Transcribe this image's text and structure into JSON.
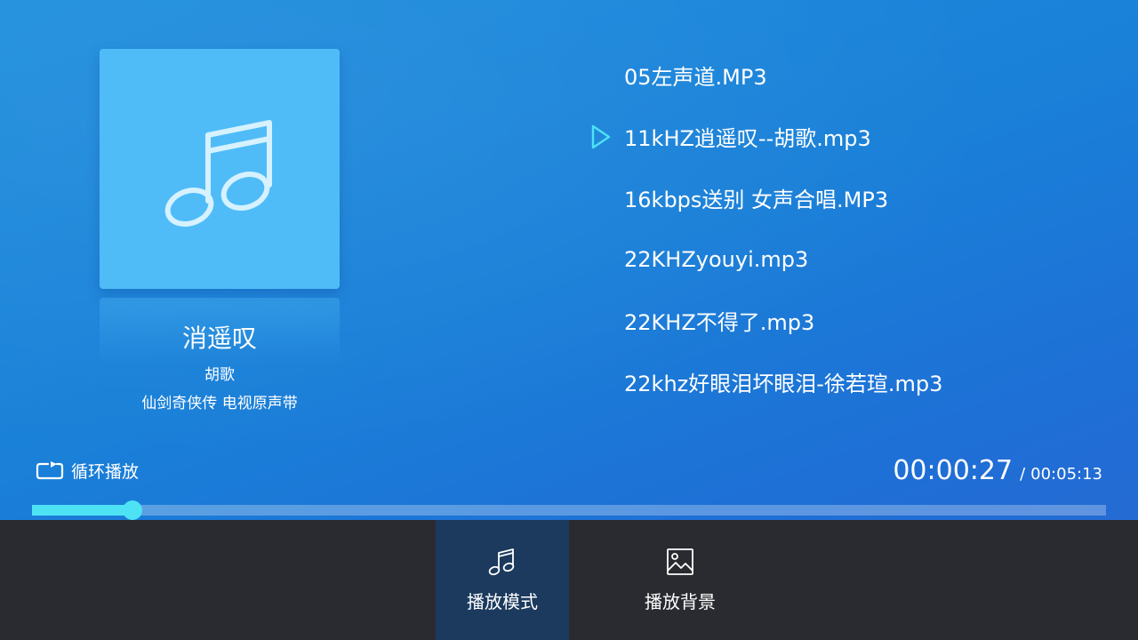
{
  "now_playing": {
    "title": "消遥叹",
    "artist": "胡歌",
    "album": "仙剑奇侠传 电视原声带",
    "cover_icon": "music-note-icon"
  },
  "playlist": {
    "current_index": 1,
    "items": [
      {
        "name": "05左声道.MP3"
      },
      {
        "name": "11kHZ逍遥叹--胡歌.mp3"
      },
      {
        "name": "16kbps送别 女声合唱.MP3"
      },
      {
        "name": "22KHZyouyi.mp3"
      },
      {
        "name": "22KHZ不得了.mp3"
      },
      {
        "name": "22khz好眼泪坏眼泪-徐若瑄.mp3"
      }
    ]
  },
  "playback": {
    "mode_label": "循环播放",
    "mode_icon": "repeat-icon",
    "current_time": "00:00:27",
    "separator": "/",
    "total_time": "00:05:13",
    "progress_fraction": 0.0935
  },
  "bottom_menu": [
    {
      "label": "播放模式",
      "icon": "music-note-icon",
      "active": true
    },
    {
      "label": "播放背景",
      "icon": "image-icon",
      "active": false
    }
  ],
  "colors": {
    "accent": "#4de3f5",
    "cover_bg": "#4fbcf8",
    "bottom_bar": "#2a2b30",
    "active_button": "#1b3a5e"
  }
}
